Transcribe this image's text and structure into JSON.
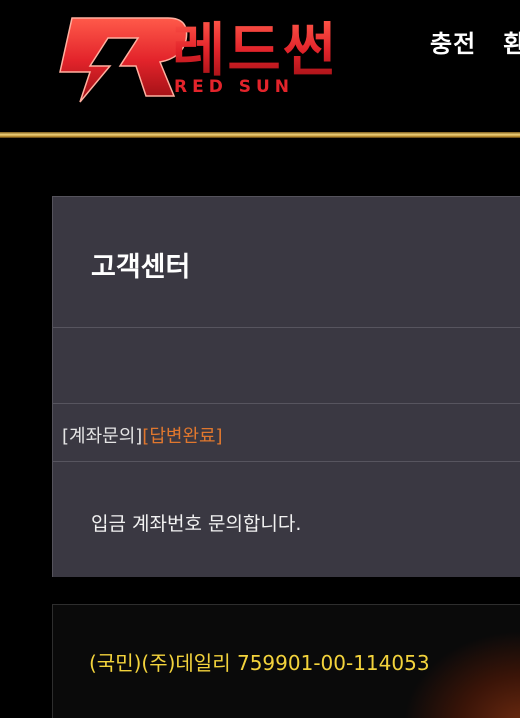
{
  "header": {
    "logo_korean": "레드썬",
    "logo_english": "RED SUN",
    "nav": [
      "충전",
      "환"
    ]
  },
  "notice": {
    "title": "고객센터",
    "category": "[계좌문의]",
    "status": "[답변완료]",
    "message": "입금 계좌번호 문의합니다."
  },
  "account": {
    "text": "(국민)(주)데일리 759901-00-114053"
  },
  "colors": {
    "logo_red": "#e3242b",
    "status_orange": "#e0772e",
    "account_yellow": "#f3d33c",
    "panel_bg": "#3a3842",
    "gold_line": "#f1d27a"
  }
}
